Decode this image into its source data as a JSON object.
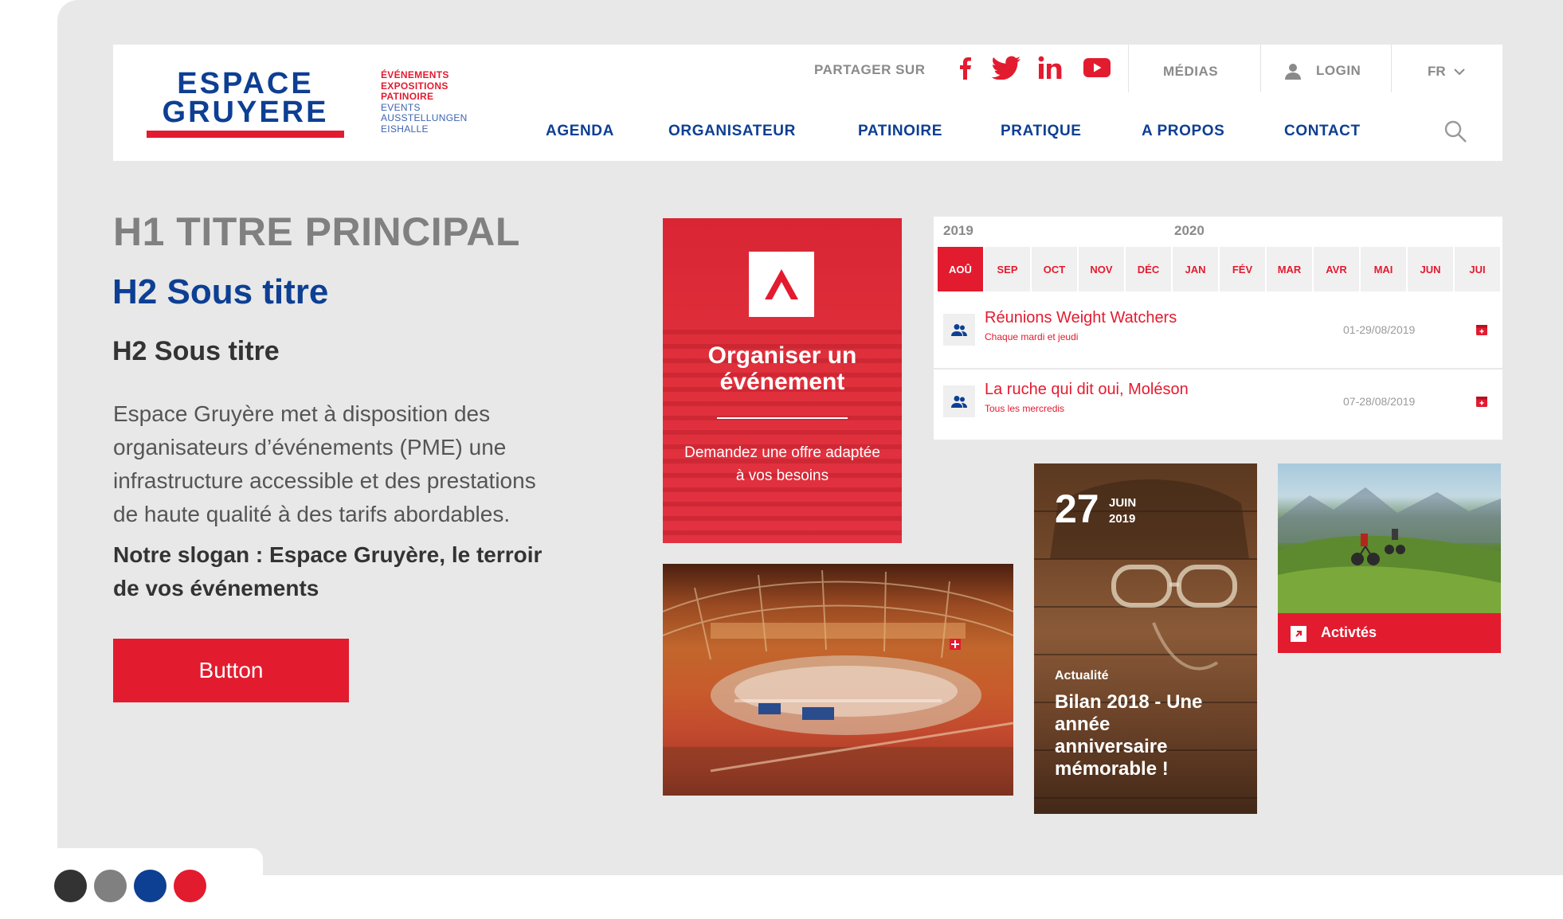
{
  "header": {
    "logo": {
      "line1": "ESPACE",
      "line2": "GRUYERE"
    },
    "tagline_fr": [
      "ÉVÉNEMENTS",
      "EXPOSITIONS",
      "PATINOIRE"
    ],
    "tagline_de": [
      "EVENTS",
      "AUSSTELLUNGEN",
      "EISHALLE"
    ],
    "share_label": "PARTAGER SUR",
    "social_icons": [
      "facebook-icon",
      "twitter-icon",
      "linkedin-icon",
      "youtube-icon"
    ],
    "medias_label": "MÉDIAS",
    "login_label": "LOGIN",
    "language": "FR",
    "nav": [
      "AGENDA",
      "ORGANISATEUR",
      "PATINOIRE",
      "PRATIQUE",
      "A PROPOS",
      "CONTACT"
    ]
  },
  "main": {
    "h1": "H1 TITRE PRINCIPAL",
    "h2_blue": "H2 Sous titre",
    "h2_dark": "H2 Sous titre",
    "body_lines": [
      "Espace Gruyère met à disposition des",
      "organisateurs d’événements (PME) une",
      "infrastructure accessible et des prestations",
      "de haute qualité à des tarifs abordables."
    ],
    "slogan_lines": [
      "Notre slogan : Espace Gruyère, le terroir",
      "de vos événements"
    ],
    "button_label": "Button"
  },
  "promo": {
    "title_lines": [
      "Organiser un",
      "événement"
    ],
    "subtitle_lines": [
      "Demandez une offre adaptée",
      "à vos besoins"
    ]
  },
  "calendar": {
    "years": [
      "2019",
      "2020"
    ],
    "months": [
      "AOÛ",
      "SEP",
      "OCT",
      "NOV",
      "DÉC",
      "JAN",
      "FÉV",
      "MAR",
      "AVR",
      "MAI",
      "JUN",
      "JUI"
    ],
    "active_month": "AOÛ",
    "events": [
      {
        "title": "Réunions Weight Watchers",
        "subtitle": "Chaque mardi et jeudi",
        "date": "01-29/08/2019"
      },
      {
        "title": "La ruche qui dit oui, Moléson",
        "subtitle": "Tous les mercredis",
        "date": "07-28/08/2019"
      }
    ]
  },
  "news": {
    "day": "27",
    "month": "JUIN",
    "year": "2019",
    "kicker": "Actualité",
    "title_lines": [
      "Bilan 2018 - Une",
      "année",
      "anniversaire",
      "mémorable !"
    ]
  },
  "activity": {
    "label": "Activtés"
  },
  "palette": [
    "#333333",
    "#808080",
    "#0d3f93",
    "#e31b2f"
  ]
}
